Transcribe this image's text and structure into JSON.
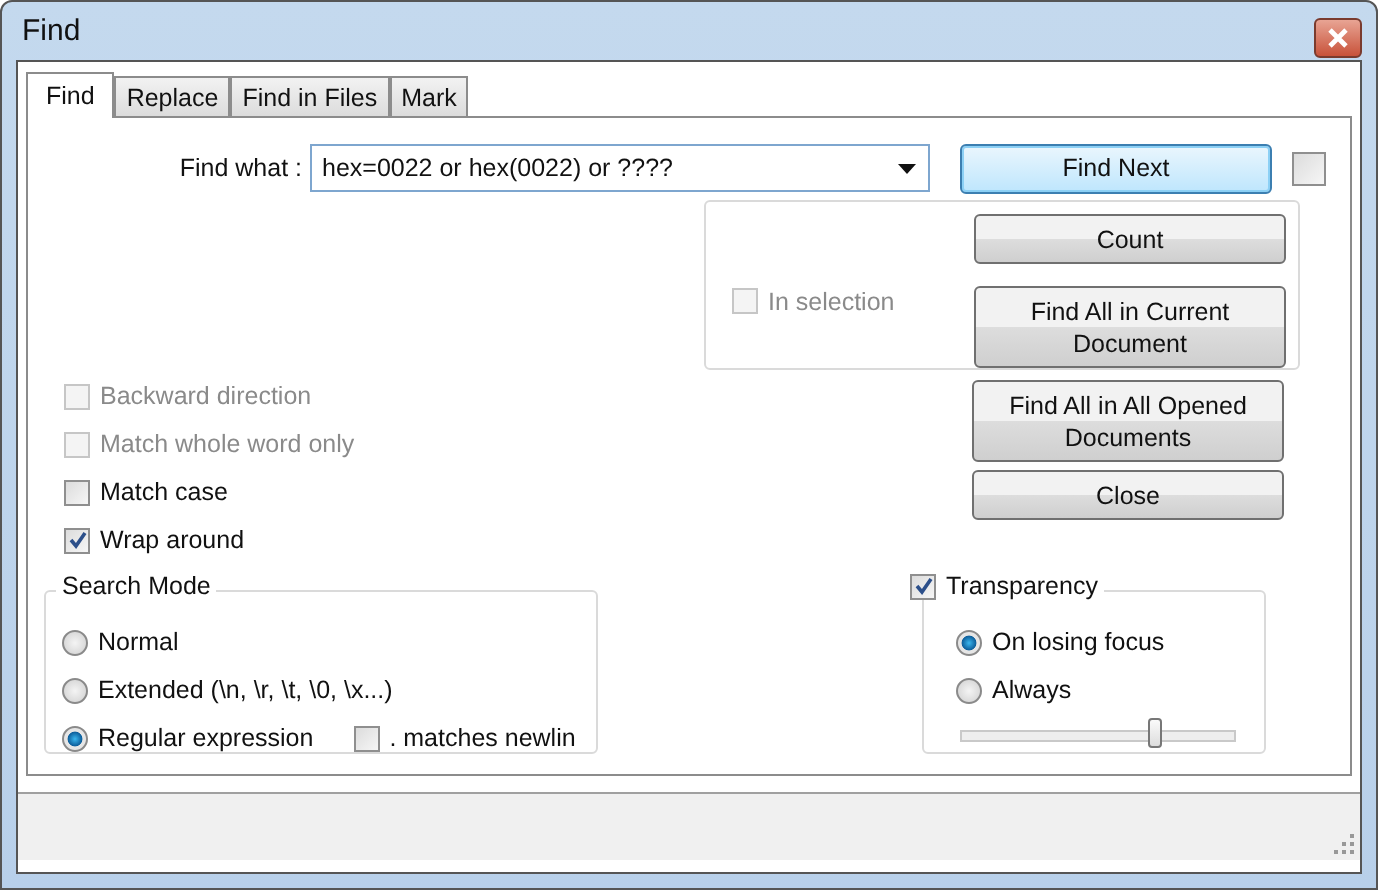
{
  "window": {
    "title": "Find"
  },
  "tabs": [
    {
      "label": "Find",
      "selected": true
    },
    {
      "label": "Replace",
      "selected": false
    },
    {
      "label": "Find in Files",
      "selected": false
    },
    {
      "label": "Mark",
      "selected": false
    }
  ],
  "find_what": {
    "label": "Find what :",
    "value": "hex=0022 or hex(0022) or ????"
  },
  "find_next": {
    "label": "Find Next",
    "checkbox_checked": false
  },
  "in_selection": {
    "label": "In selection",
    "checked": false,
    "disabled": true
  },
  "group_buttons": [
    {
      "label": "Count"
    },
    {
      "label": "Find All in Current Document"
    }
  ],
  "buttons": [
    {
      "label": "Find All in All Opened Documents"
    },
    {
      "label": "Close"
    }
  ],
  "options": [
    {
      "label": "Backward direction",
      "checked": false,
      "disabled": true
    },
    {
      "label": "Match whole word only",
      "checked": false,
      "disabled": true
    },
    {
      "label": "Match case",
      "checked": false,
      "disabled": false
    },
    {
      "label": "Wrap around",
      "checked": true,
      "disabled": false
    }
  ],
  "search_mode": {
    "title": "Search Mode",
    "options": [
      {
        "label": "Normal",
        "selected": false
      },
      {
        "label": "Extended (\\n, \\r, \\t, \\0, \\x...)",
        "selected": false
      },
      {
        "label": "Regular expression",
        "selected": true
      }
    ],
    "newline": {
      "label": ". matches newlin",
      "checked": false
    }
  },
  "transparency": {
    "label": "Transparency",
    "checked": true,
    "options": [
      {
        "label": "On losing focus",
        "selected": true
      },
      {
        "label": "Always",
        "selected": false
      }
    ],
    "level": 0.71
  }
}
